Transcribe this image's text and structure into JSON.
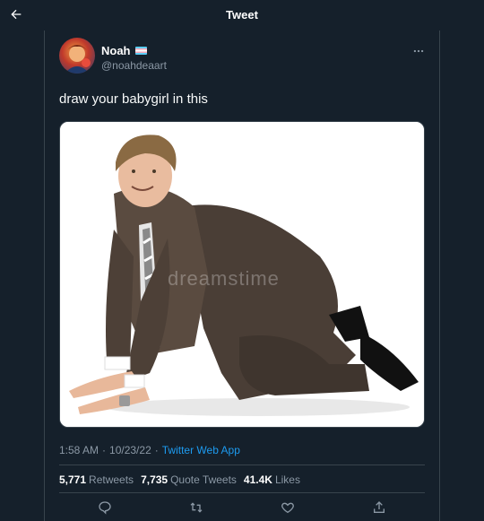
{
  "header": {
    "title": "Tweet",
    "back_icon": "arrow-left-icon"
  },
  "tweet": {
    "author": {
      "name": "Noah",
      "handle": "@noahdeaart",
      "flag_icon": "trans-flag-icon"
    },
    "text": "draw your babygirl in this",
    "media": {
      "watermark": "dreamstime"
    },
    "meta": {
      "time": "1:58 AM",
      "date": "10/23/22",
      "separator": "·",
      "source": "Twitter Web App"
    },
    "stats": {
      "retweets": {
        "count": "5,771",
        "label": "Retweets"
      },
      "quote_tweets": {
        "count": "7,735",
        "label": "Quote Tweets"
      },
      "likes": {
        "count": "41.4K",
        "label": "Likes"
      }
    },
    "actions": [
      "reply-icon",
      "retweet-icon",
      "like-icon",
      "share-icon"
    ]
  },
  "colors": {
    "background": "#15202b",
    "border": "#38444d",
    "secondary_text": "#8b98a5",
    "accent": "#1d9bf0"
  }
}
